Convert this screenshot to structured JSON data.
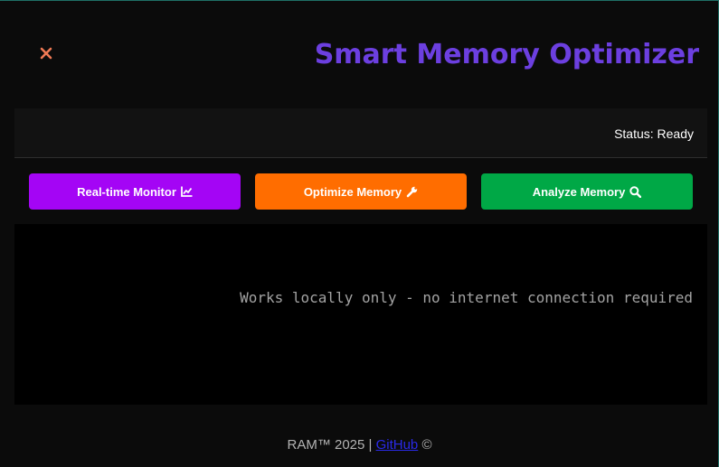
{
  "header": {
    "close_icon": "close-icon",
    "title": "Smart Memory Optimizer"
  },
  "status": {
    "text": "Status: Ready"
  },
  "actions": {
    "monitor": {
      "label": "Real-time Monitor",
      "icon": "line-chart-icon"
    },
    "optimize": {
      "label": "Optimize Memory",
      "icon": "wrench-icon"
    },
    "analyze": {
      "label": "Analyze Memory",
      "icon": "magnifier-icon"
    }
  },
  "console": {
    "message": "Works locally only - no internet connection required"
  },
  "footer": {
    "prefix": "RAM™ 2025 |",
    "link_label": "GitHub",
    "suffix": "©"
  },
  "colors": {
    "title": "#6c3fe0",
    "close": "#f07a55",
    "monitor": "#a405f5",
    "optimize": "#ff6d00",
    "analyze": "#00a846"
  }
}
